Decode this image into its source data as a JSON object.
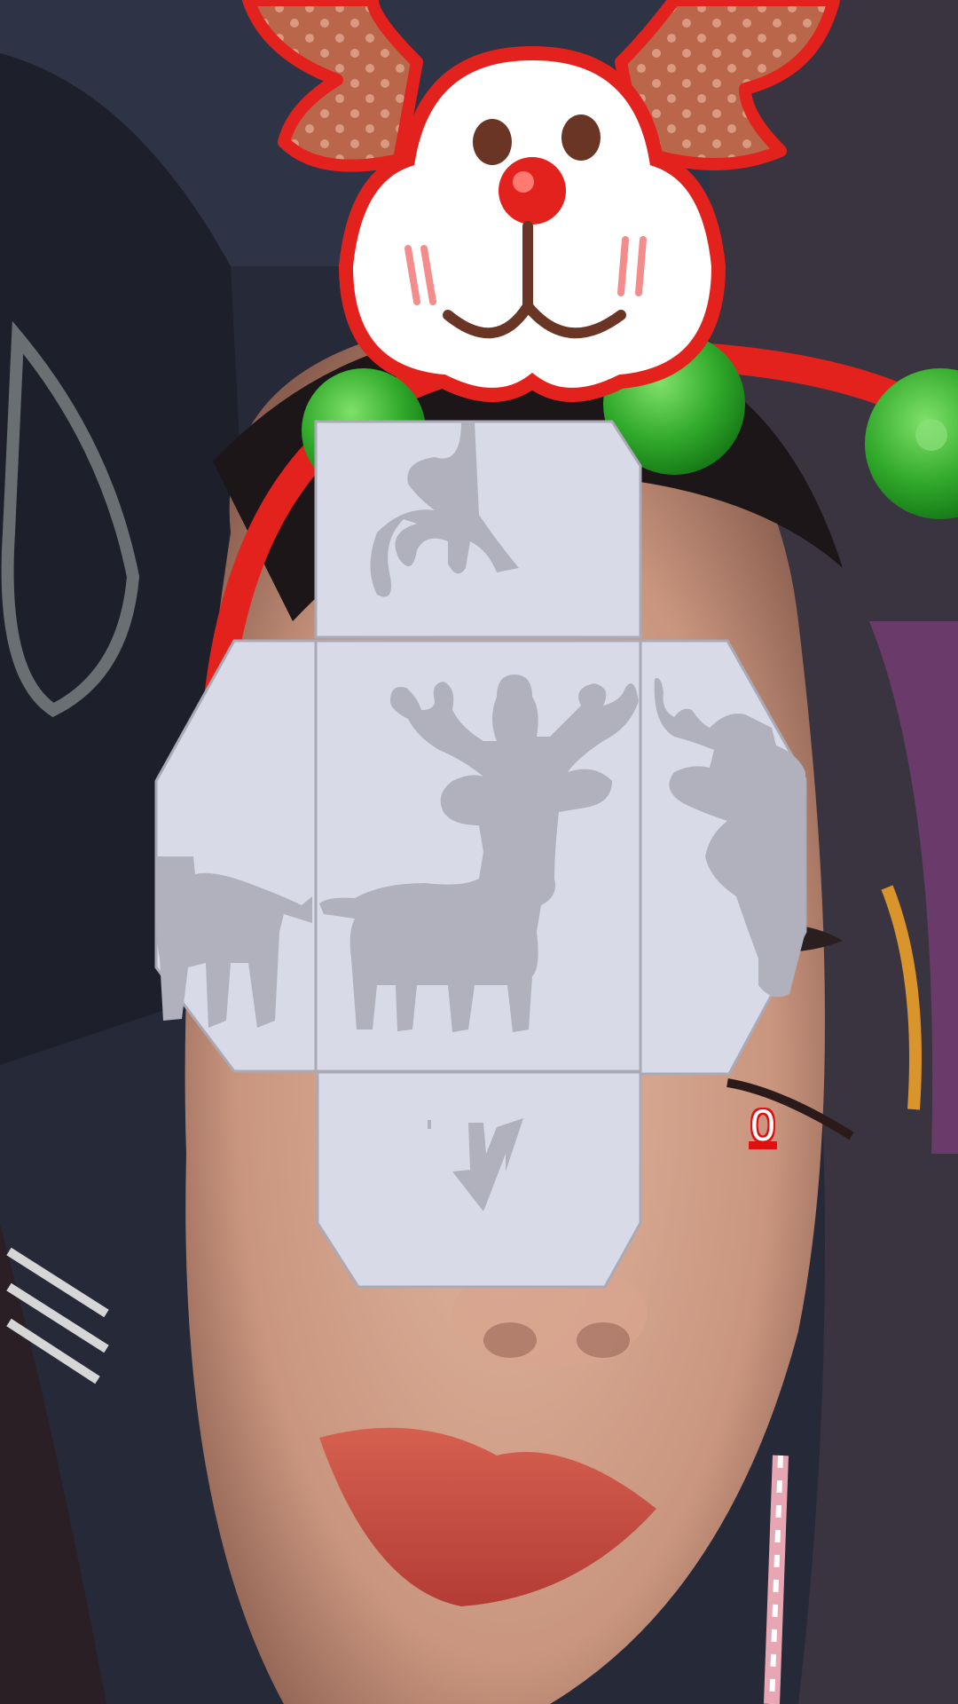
{
  "game": {
    "score": "0",
    "filter": "reindeer-antlers-headband",
    "puzzle": {
      "shape": "cross",
      "pieces": [
        {
          "id": "top",
          "content": "antler-fragment"
        },
        {
          "id": "left",
          "content": "reindeer-body-fragment"
        },
        {
          "id": "center",
          "content": "reindeer-silhouette"
        },
        {
          "id": "right",
          "content": "reindeer-head-fragment"
        },
        {
          "id": "bottom",
          "content": "arrow-down"
        }
      ]
    },
    "colors": {
      "tile": "#d8dae7",
      "tile_border": "#a9aab6",
      "silhouette": "#b0b1bd",
      "headband_red": "#e4221d",
      "pompom_green": "#2fa82a",
      "score_stroke": "#e01010"
    }
  }
}
